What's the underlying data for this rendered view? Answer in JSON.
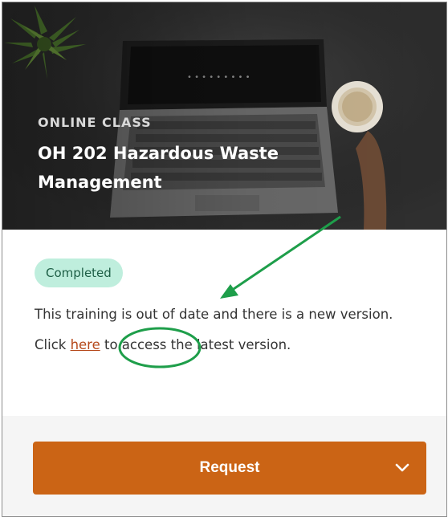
{
  "card": {
    "eyebrow": "ONLINE CLASS",
    "title": "OH 202 Hazardous Waste Management",
    "status_badge": "Completed",
    "message_before_link": "This training is out of date and there is a new version. Click ",
    "link_text": "here",
    "message_after_link": " to access the latest version.",
    "request_label": "Request"
  },
  "icons": {
    "hero_image": "laptop-desk-photo",
    "dropdown": "chevron-down-icon",
    "annotation": "green-arrow-and-circle"
  },
  "colors": {
    "badge_bg": "#bfeedd",
    "link": "#b5481a",
    "button": "#cb6415",
    "annotation": "#1e9e4a"
  }
}
